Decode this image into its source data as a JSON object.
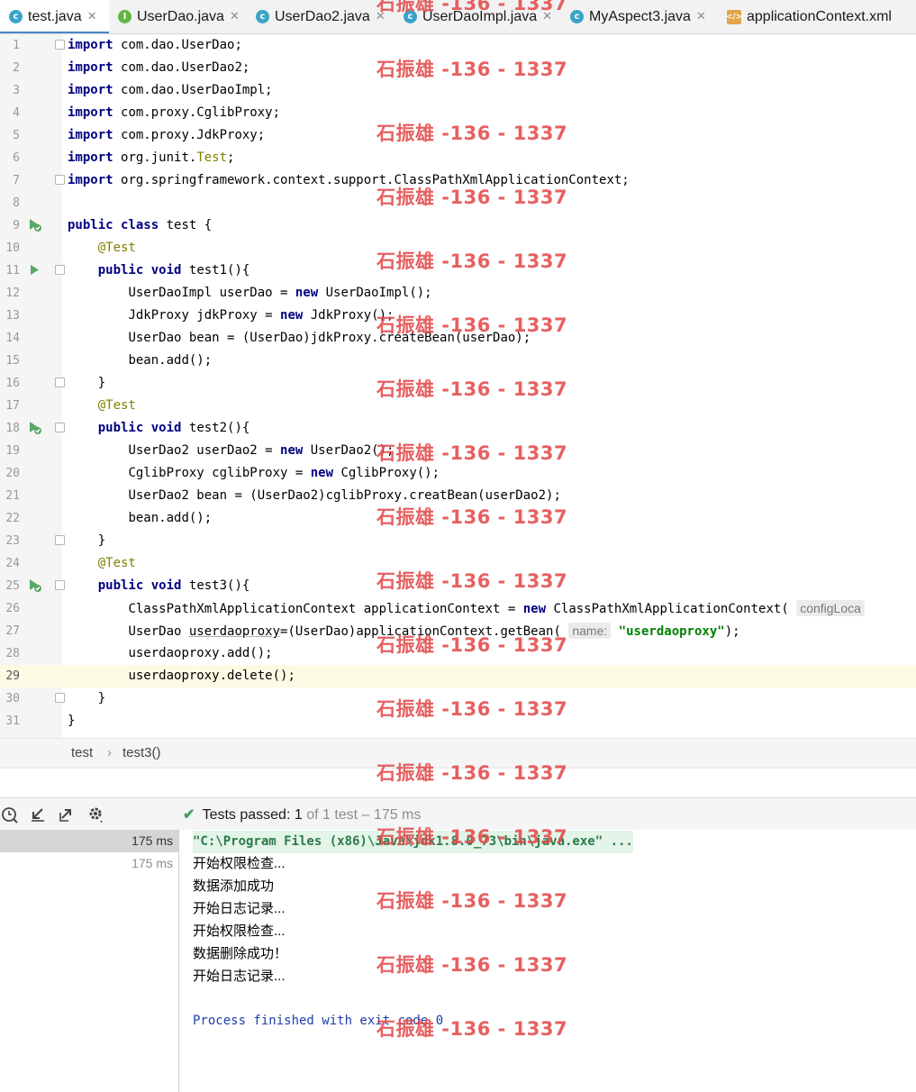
{
  "tabs": [
    {
      "label": "test.java",
      "icon": "class-c-icon",
      "active": true
    },
    {
      "label": "UserDao.java",
      "icon": "interface-i-icon"
    },
    {
      "label": "UserDao2.java",
      "icon": "class-c-icon"
    },
    {
      "label": "UserDaoImpl.java",
      "icon": "class-c-icon"
    },
    {
      "label": "MyAspect3.java",
      "icon": "class-c-icon"
    },
    {
      "label": "applicationContext.xml",
      "icon": "xml-file-icon"
    }
  ],
  "editor": {
    "line_numbers": [
      "1",
      "2",
      "3",
      "4",
      "5",
      "6",
      "7",
      "8",
      "9",
      "10",
      "11",
      "12",
      "13",
      "14",
      "15",
      "16",
      "17",
      "18",
      "19",
      "20",
      "21",
      "22",
      "23",
      "24",
      "25",
      "26",
      "27",
      "28",
      "29",
      "30",
      "31"
    ],
    "current_line": 29,
    "tokens": {
      "import": "import",
      "l1": "com.dao.UserDao;",
      "l2": "com.dao.UserDao2;",
      "l3": "com.dao.UserDaoImpl;",
      "l4": "com.proxy.CglibProxy;",
      "l5": "com.proxy.JdkProxy;",
      "l6a": "org.junit.",
      "l6b": "Test",
      "l6c": ";",
      "l7": "org.springframework.context.support.ClassPathXmlApplicationContext;",
      "public": "public",
      "class": "class",
      "l9": "test {",
      "atTest": "@Test",
      "void": "void",
      "new": "new",
      "l11": "test1(){",
      "l12a": "UserDaoImpl userDao = ",
      "l12b": "UserDaoImpl();",
      "l13a": "JdkProxy jdkProxy = ",
      "l13b": "JdkProxy();",
      "l14": "UserDao bean = (UserDao)jdkProxy.createBean(userDao);",
      "l15": "bean.add();",
      "close": "}",
      "l18": "test2(){",
      "l19a": "UserDao2 userDao2 = ",
      "l19b": "UserDao2();",
      "l20a": "CglibProxy cglibProxy = ",
      "l20b": "CglibProxy();",
      "l21": "UserDao2 bean = (UserDao2)cglibProxy.creatBean(userDao2);",
      "l22": "bean.add();",
      "l25": "test3(){",
      "l26a": "ClassPathXmlApplicationContext applicationContext = ",
      "l26b": "ClassPathXmlApplicationContext(",
      "l26hint": "configLoca",
      "l27a": "UserDao ",
      "l27b": "userdaoproxy",
      "l27c": "=(UserDao)applicationContext.getBean(",
      "l27hint": "name:",
      "l27str": "\"userdaoproxy\"",
      "l27d": ");",
      "l28": "userdaoproxy.add();",
      "l29": "userdaoproxy.delete();"
    }
  },
  "breadcrumb": {
    "items": [
      "test",
      "test3()"
    ],
    "separator": "›"
  },
  "run_panel": {
    "status_prefix": "Tests passed:",
    "status_count": "1",
    "status_suffix": "of 1 test – 175 ms",
    "tree": [
      {
        "time": "175 ms",
        "selected": true
      },
      {
        "time": "175 ms",
        "selected": false
      }
    ],
    "console": {
      "command": "\"C:\\Program Files (x86)\\Java\\jdk1.8.0_73\\bin\\java.exe\" ...",
      "lines": [
        "开始权限检查...",
        "数据添加成功",
        "开始日志记录...",
        "开始权限检查...",
        "数据删除成功！",
        "开始日志记录..."
      ],
      "exit": "Process finished with exit code 0"
    }
  },
  "watermark": "石振雄 -136 - 1337",
  "colors": {
    "keyword": "#000080",
    "annotation": "#808000",
    "string": "#008000",
    "watermark": "#e34b4b",
    "tab_underline": "#4a88c7"
  }
}
